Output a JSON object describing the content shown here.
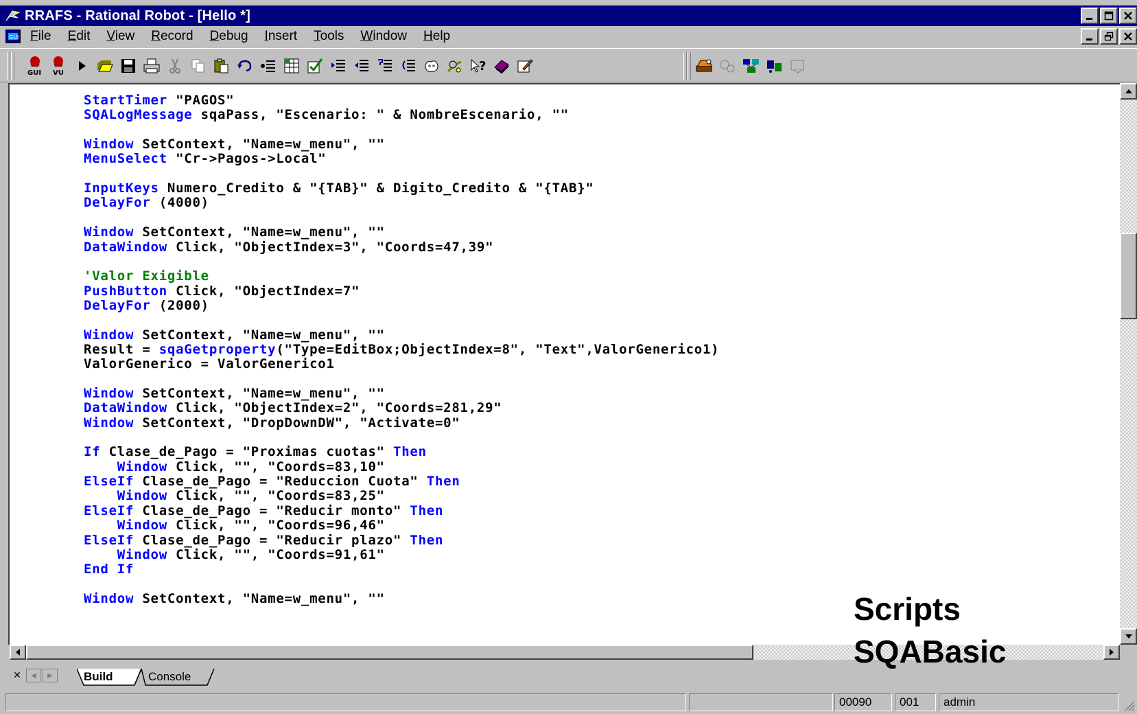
{
  "window": {
    "title": "RRAFS - Rational Robot - [Hello *]",
    "minimize": "_",
    "maximize": "□",
    "close": "✕",
    "restore": "🗗"
  },
  "menu": [
    {
      "accel": "F",
      "rest": "ile"
    },
    {
      "accel": "E",
      "rest": "dit"
    },
    {
      "accel": "V",
      "rest": "iew"
    },
    {
      "accel": "R",
      "rest": "ecord"
    },
    {
      "accel": "D",
      "rest": "ebug"
    },
    {
      "accel": "I",
      "rest": "nsert"
    },
    {
      "accel": "T",
      "rest": "ools"
    },
    {
      "accel": "W",
      "rest": "indow"
    },
    {
      "accel": "H",
      "rest": "elp"
    }
  ],
  "toolbar": {
    "gui_label": "GUI",
    "vu_label": "VU"
  },
  "code": [
    {
      "l": 0,
      "segs": [
        [
          "StartTimer",
          "kw"
        ],
        [
          " \"PAGOS\"",
          ""
        ]
      ]
    },
    {
      "l": 1,
      "segs": [
        [
          "SQALogMessage",
          "kw"
        ],
        [
          " sqaPass, \"Escenario: \" & NombreEscenario, \"\"",
          ""
        ]
      ]
    },
    {
      "l": 3,
      "segs": [
        [
          "Window",
          "kw"
        ],
        [
          " SetContext, \"Name=w_menu\", \"\"",
          ""
        ]
      ]
    },
    {
      "l": 4,
      "segs": [
        [
          "MenuSelect",
          "kw"
        ],
        [
          " \"Cr->Pagos->Local\"",
          ""
        ]
      ]
    },
    {
      "l": 6,
      "segs": [
        [
          "InputKeys",
          "kw"
        ],
        [
          " Numero_Credito & \"{TAB}\" & Digito_Credito & \"{TAB}\"",
          ""
        ]
      ]
    },
    {
      "l": 7,
      "segs": [
        [
          "DelayFor",
          "kw"
        ],
        [
          " (4000)",
          ""
        ]
      ]
    },
    {
      "l": 9,
      "segs": [
        [
          "Window",
          "kw"
        ],
        [
          " SetContext, \"Name=w_menu\", \"\"",
          ""
        ]
      ]
    },
    {
      "l": 10,
      "segs": [
        [
          "DataWindow",
          "kw"
        ],
        [
          " Click, \"ObjectIndex=3\", \"Coords=47,39\"",
          ""
        ]
      ]
    },
    {
      "l": 12,
      "segs": [
        [
          "'Valor Exigible",
          "cm"
        ]
      ]
    },
    {
      "l": 13,
      "segs": [
        [
          "PushButton",
          "kw"
        ],
        [
          " Click, \"ObjectIndex=7\"",
          ""
        ]
      ]
    },
    {
      "l": 14,
      "segs": [
        [
          "DelayFor",
          "kw"
        ],
        [
          " (2000)",
          ""
        ]
      ]
    },
    {
      "l": 16,
      "segs": [
        [
          "Window",
          "kw"
        ],
        [
          " SetContext, \"Name=w_menu\", \"\"",
          ""
        ]
      ]
    },
    {
      "l": 17,
      "segs": [
        [
          "Result = ",
          ""
        ],
        [
          "sqaGetproperty",
          "kw"
        ],
        [
          "(\"Type=EditBox;ObjectIndex=8\", \"Text\",ValorGenerico1)",
          ""
        ]
      ]
    },
    {
      "l": 18,
      "segs": [
        [
          "ValorGenerico = ValorGenerico1",
          ""
        ]
      ]
    },
    {
      "l": 20,
      "segs": [
        [
          "Window",
          "kw"
        ],
        [
          " SetContext, \"Name=w_menu\", \"\"",
          ""
        ]
      ]
    },
    {
      "l": 21,
      "segs": [
        [
          "DataWindow",
          "kw"
        ],
        [
          " Click, \"ObjectIndex=2\", \"Coords=281,29\"",
          ""
        ]
      ]
    },
    {
      "l": 22,
      "segs": [
        [
          "Window",
          "kw"
        ],
        [
          " SetContext, \"DropDownDW\", \"Activate=0\"",
          ""
        ]
      ]
    },
    {
      "l": 24,
      "segs": [
        [
          "If",
          "kw"
        ],
        [
          " Clase_de_Pago = \"Proximas cuotas\" ",
          ""
        ],
        [
          "Then",
          "kw"
        ]
      ]
    },
    {
      "l": 25,
      "segs": [
        [
          "    ",
          ""
        ],
        [
          "Window",
          "kw"
        ],
        [
          " Click, \"\", \"Coords=83,10\"",
          ""
        ]
      ]
    },
    {
      "l": 26,
      "segs": [
        [
          "ElseIf",
          "kw"
        ],
        [
          " Clase_de_Pago = \"Reduccion Cuota\" ",
          ""
        ],
        [
          "Then",
          "kw"
        ]
      ]
    },
    {
      "l": 27,
      "segs": [
        [
          "    ",
          ""
        ],
        [
          "Window",
          "kw"
        ],
        [
          " Click, \"\", \"Coords=83,25\"",
          ""
        ]
      ]
    },
    {
      "l": 28,
      "segs": [
        [
          "ElseIf",
          "kw"
        ],
        [
          " Clase_de_Pago = \"Reducir monto\" ",
          ""
        ],
        [
          "Then",
          "kw"
        ]
      ]
    },
    {
      "l": 29,
      "segs": [
        [
          "    ",
          ""
        ],
        [
          "Window",
          "kw"
        ],
        [
          " Click, \"\", \"Coords=96,46\"",
          ""
        ]
      ]
    },
    {
      "l": 30,
      "segs": [
        [
          "ElseIf",
          "kw"
        ],
        [
          " Clase_de_Pago = \"Reducir plazo\" ",
          ""
        ],
        [
          "Then",
          "kw"
        ]
      ]
    },
    {
      "l": 31,
      "segs": [
        [
          "    ",
          ""
        ],
        [
          "Window",
          "kw"
        ],
        [
          " Click, \"\", \"Coords=91,61\"",
          ""
        ]
      ]
    },
    {
      "l": 32,
      "segs": [
        [
          "End If",
          "kw"
        ]
      ]
    },
    {
      "l": 34,
      "segs": [
        [
          "Window",
          "kw"
        ],
        [
          " SetContext, \"Name=w_menu\", \"\"",
          ""
        ]
      ]
    }
  ],
  "tabs": [
    {
      "label": "Build",
      "active": true
    },
    {
      "label": "Console",
      "active": false
    }
  ],
  "status": {
    "line": "00090",
    "col": "001",
    "user": "admin"
  },
  "overlay": {
    "line1": "Scripts",
    "line2": "SQABasic"
  },
  "colors": {
    "titlebar": "#000080",
    "keyword": "#0000ff",
    "comment": "#008000",
    "chrome": "#c0c0c0"
  }
}
